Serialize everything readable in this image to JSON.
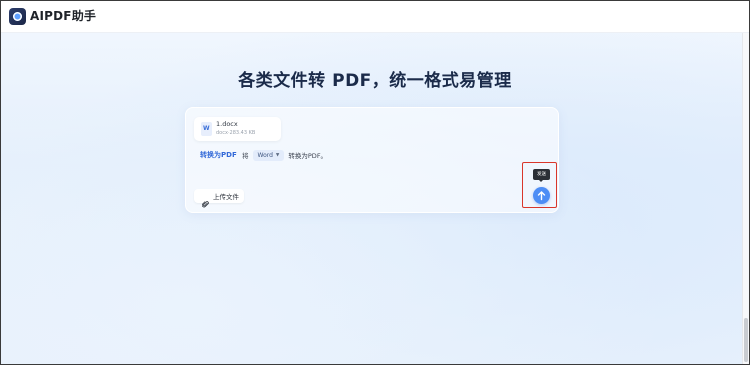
{
  "app": {
    "title": "AIPDF助手",
    "logo_icon": "aipdf-logo-icon"
  },
  "hero": {
    "headline": "各类文件转 PDF，统一格式易管理"
  },
  "attachment": {
    "name": "1.docx",
    "meta": "docx·283.43 KB",
    "icon": "word-file-icon",
    "icon_letter": "W"
  },
  "conversion": {
    "tab_label": "转换为PDF",
    "prefix": "将",
    "source_format": "Word",
    "suffix": "转换为PDF。"
  },
  "upload": {
    "label": "上传文件",
    "icon": "paperclip-icon"
  },
  "send": {
    "tooltip": "发送",
    "icon": "arrow-up-icon"
  },
  "colors": {
    "accent": "#3269d8",
    "send_button": "#4d8df5",
    "highlight": "#d9362b",
    "headline": "#1b2b4a"
  }
}
